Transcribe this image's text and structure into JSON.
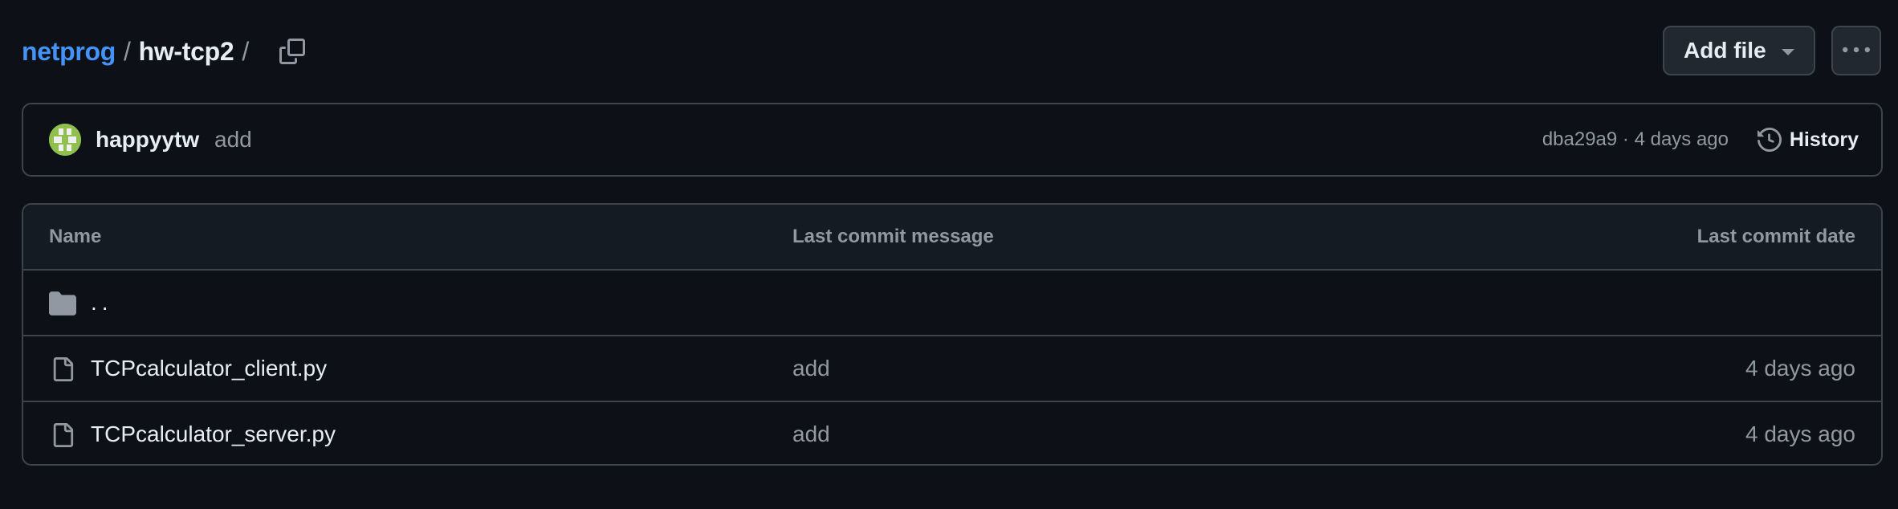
{
  "breadcrumb": {
    "owner": "netprog",
    "separator": "/",
    "repo": "hw-tcp2",
    "trailing_separator": "/"
  },
  "toolbar": {
    "add_file_label": "Add file",
    "more_icon": "kebab-horizontal-icon",
    "copy_icon": "copy-icon"
  },
  "latest_commit": {
    "author": "happyytw",
    "message": "add",
    "sha": "dba29a9",
    "meta_separator": " · ",
    "when": "4 days ago",
    "history_label": "History",
    "history_icon": "history-icon"
  },
  "table": {
    "headers": {
      "name": "Name",
      "message": "Last commit message",
      "date": "Last commit date"
    },
    "rows": [
      {
        "type": "parent-directory",
        "icon": "folder-icon",
        "name": "..",
        "message": "",
        "date": ""
      },
      {
        "type": "file",
        "icon": "file-icon",
        "name": "TCPcalculator_client.py",
        "message": "add",
        "date": "4 days ago"
      },
      {
        "type": "file",
        "icon": "file-icon",
        "name": "TCPcalculator_server.py",
        "message": "add",
        "date": "4 days ago"
      }
    ]
  },
  "colors": {
    "background": "#0d1117",
    "border": "#3d444d",
    "link": "#4493f8",
    "text": "#e6edf3",
    "muted": "#9198a1",
    "avatar": "#8fbf4d"
  }
}
